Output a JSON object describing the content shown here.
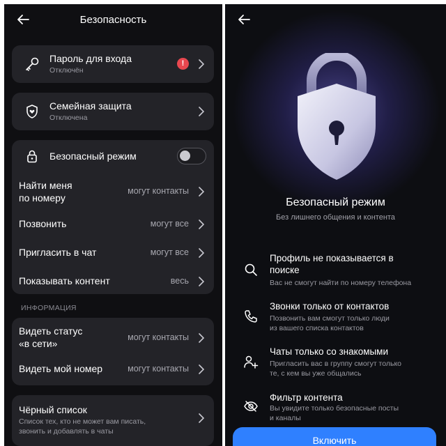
{
  "left": {
    "title": "Безопасность",
    "password": {
      "label": "Пароль для входа",
      "status": "Отключён",
      "alert": "!"
    },
    "family": {
      "label": "Семейная защита",
      "status": "Отключена"
    },
    "safe_mode": {
      "label": "Безопасный режим",
      "enabled": false
    },
    "settings": [
      {
        "label": "Найти меня\nпо номеру",
        "value": "могут контакты"
      },
      {
        "label": "Позвонить",
        "value": "могут все"
      },
      {
        "label": "Пригласить в чат",
        "value": "могут все"
      },
      {
        "label": "Показывать контент",
        "value": "весь"
      }
    ],
    "info_header": "ИНФОРМАЦИЯ",
    "info": [
      {
        "label": "Видеть статус\n«в сети»",
        "value": "могут контакты"
      },
      {
        "label": "Видеть мой номер",
        "value": "могут контакты"
      }
    ],
    "blacklist": {
      "label": "Чёрный список",
      "desc": "Список тех, кто не может вам писать,\nзвонить и добавлять в чаты"
    }
  },
  "right": {
    "title": "Безопасный режим",
    "subtitle": "Без лишнего общения и контента",
    "features": [
      {
        "icon": "search-icon",
        "title": "Профиль не показывается в\nпоиске",
        "desc": "Вас не смогут найти по номеру телефона"
      },
      {
        "icon": "phone-icon",
        "title": "Звонки только от контактов",
        "desc": "Позвонить вам смогут только люди\nиз вашего списка контактов"
      },
      {
        "icon": "add-user-icon",
        "title": "Чаты только со знакомыми",
        "desc": "Пригласить вас в группу смогут только\nте, с кем вы уже общались"
      },
      {
        "icon": "eye-off-icon",
        "title": "Фильтр контента",
        "desc": "Вы увидите только безопасные посты\nи каналы"
      }
    ],
    "button_label": "Включить"
  },
  "colors": {
    "accent": "#2f80ff",
    "alert": "#e8474f",
    "card": "#232328"
  }
}
